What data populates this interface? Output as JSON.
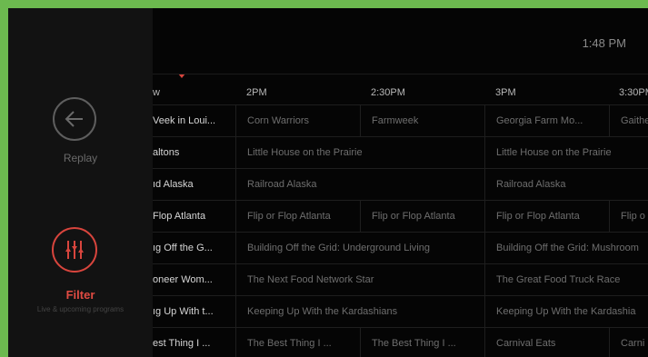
{
  "header": {
    "clock": "1:48 PM"
  },
  "sidebar": {
    "replay": {
      "label": "Replay",
      "icon": "back-arrow-icon"
    },
    "filter": {
      "label": "Filter",
      "subtitle": "Live & upcoming programs",
      "icon": "equalizer-icon"
    }
  },
  "colors": {
    "accent": "#d8453d",
    "background": "#050505",
    "sidebar": "#121212",
    "frame": "#6cb94f"
  },
  "timeline": {
    "slots": [
      "w",
      "2PM",
      "2:30PM",
      "3PM",
      "3:30PM"
    ]
  },
  "rows": [
    {
      "cells": [
        "Veek in Loui...",
        "Corn Warriors",
        "Farmweek",
        "Georgia Farm Mo...",
        "Gaithe"
      ]
    },
    {
      "cells": [
        "altons",
        "Little House on the Prairie",
        "Little House on the Prairie"
      ]
    },
    {
      "cells": [
        "ıd Alaska",
        "Railroad Alaska",
        "Railroad Alaska"
      ]
    },
    {
      "cells": [
        "Flop Atlanta",
        "Flip or Flop Atlanta",
        "Flip or Flop Atlanta",
        "Flip or Flop Atlanta",
        "Flip o"
      ]
    },
    {
      "cells": [
        "ıg Off the G...",
        "Building Off the Grid: Underground Living",
        "Building Off the Grid: Mushroom"
      ]
    },
    {
      "cells": [
        "oneer Wom...",
        "The Next Food Network Star",
        "The Great Food Truck Race"
      ]
    },
    {
      "cells": [
        "ıg Up With t...",
        "Keeping Up With the Kardashians",
        "Keeping Up With the Kardashia"
      ]
    },
    {
      "cells": [
        "est Thing I ...",
        "The Best Thing I ...",
        "The Best Thing I ...",
        "Carnival Eats",
        "Carni"
      ]
    }
  ]
}
